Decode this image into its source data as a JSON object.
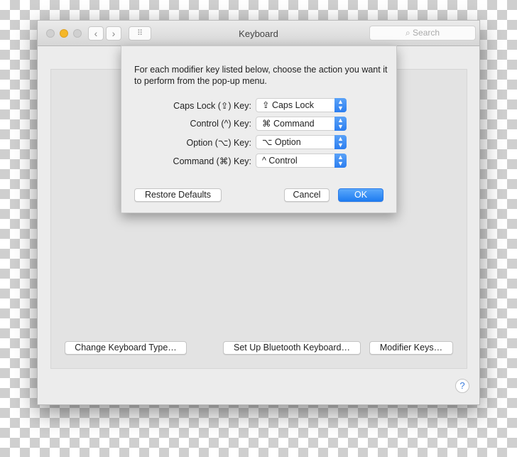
{
  "window": {
    "title": "Keyboard",
    "search_placeholder": "Search",
    "back": "‹",
    "forward": "›",
    "grid": "⠿"
  },
  "panel": {
    "buttons": [
      "Change Keyboard Type…",
      "Set Up Bluetooth Keyboard…",
      "Modifier Keys…"
    ],
    "help": "?"
  },
  "sheet": {
    "description": "For each modifier key listed below, choose the action you want it to perform from the pop-up menu.",
    "rows": [
      {
        "label": "Caps Lock (⇪) Key:",
        "value": "⇪ Caps Lock"
      },
      {
        "label": "Control (^) Key:",
        "value": "⌘ Command"
      },
      {
        "label": "Option (⌥) Key:",
        "value": "⌥ Option"
      },
      {
        "label": "Command (⌘) Key:",
        "value": "^ Control"
      }
    ],
    "restore": "Restore Defaults",
    "cancel": "Cancel",
    "ok": "OK"
  },
  "colors": {
    "accent": "#2c7ef0",
    "minimize": "#f5b728"
  }
}
